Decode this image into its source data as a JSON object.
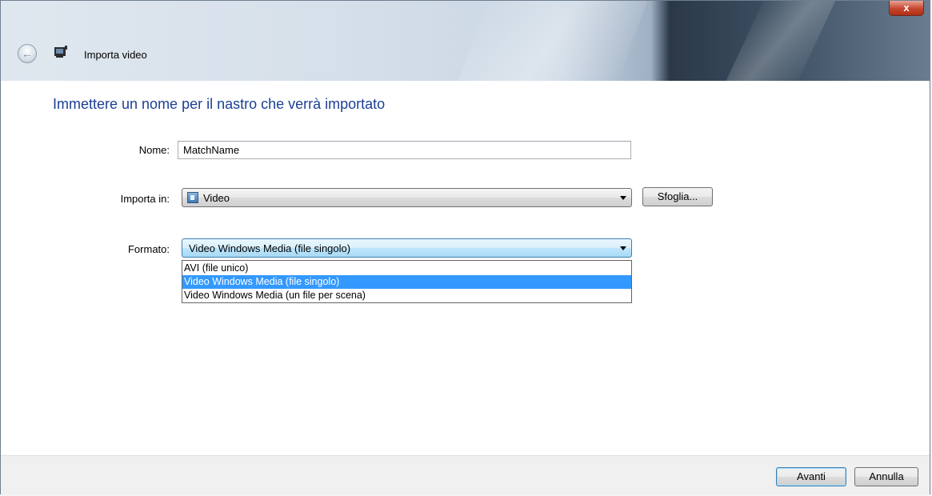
{
  "window": {
    "title": "Importa video",
    "close_symbol": "x",
    "back_icon": "back-arrow-icon",
    "app_icon": "camera-icon"
  },
  "main": {
    "instruction": "Immettere un nome per il nastro che verrà importato",
    "name_label": "Nome:",
    "name_value": "MatchName",
    "import_label": "Importa in:",
    "import_value": "Video",
    "browse_label": "Sfoglia...",
    "format_label": "Formato:",
    "format_value": "Video Windows Media (file singolo)",
    "format_options": [
      {
        "label": "AVI (file unico)",
        "selected": false
      },
      {
        "label": "Video Windows Media (file singolo)",
        "selected": true
      },
      {
        "label": "Video Windows Media (un file per scena)",
        "selected": false
      }
    ]
  },
  "footer": {
    "next_label": "Avanti",
    "cancel_label": "Annulla"
  },
  "colors": {
    "instruction_text": "#1c3f94",
    "selection": "#3399ff",
    "close_button": "#c6452e"
  }
}
